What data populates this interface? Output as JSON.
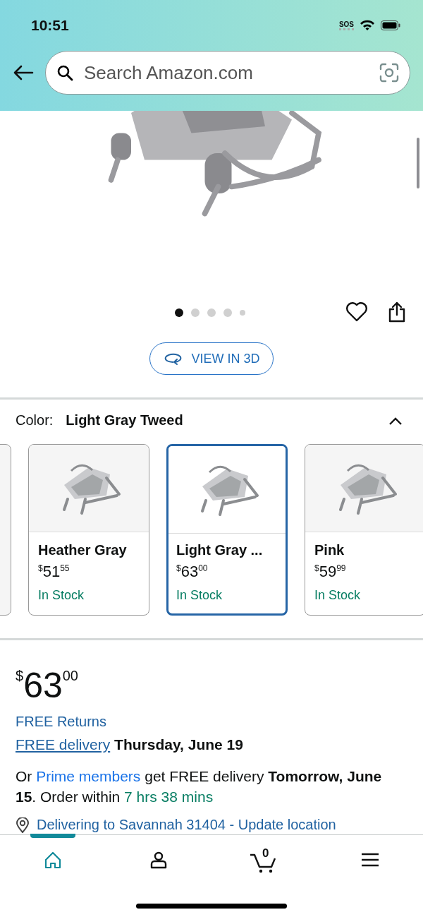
{
  "status_bar": {
    "time": "10:51",
    "sos": "SOS"
  },
  "search": {
    "placeholder": "Search Amazon.com"
  },
  "gallery": {
    "dots": [
      {
        "selected": true
      },
      {
        "selected": false
      },
      {
        "selected": false
      },
      {
        "selected": false
      },
      {
        "selected": false
      }
    ],
    "view_3d": "VIEW IN 3D"
  },
  "color": {
    "label": "Color:",
    "value": "Light Gray Tweed",
    "expanded": true
  },
  "swatches": [
    {
      "name": "Heather Gray",
      "price": {
        "currency": "$",
        "whole": "51",
        "fraction": "55"
      },
      "stock": "In Stock",
      "selected": false
    },
    {
      "name": "Light Gray ...",
      "price": {
        "currency": "$",
        "whole": "63",
        "fraction": "00"
      },
      "stock": "In Stock",
      "selected": true
    },
    {
      "name": "Pink",
      "price": {
        "currency": "$",
        "whole": "59",
        "fraction": "99"
      },
      "stock": "In Stock",
      "selected": false
    }
  ],
  "price": {
    "currency": "$",
    "whole": "63",
    "fraction": "00"
  },
  "returns": "FREE Returns",
  "delivery": [
    {
      "kind": "link",
      "text": "FREE delivery"
    },
    {
      "kind": "bold",
      "text": "Thursday, June 19"
    }
  ],
  "prime": [
    {
      "kind": "plain",
      "text": "Or "
    },
    {
      "kind": "link",
      "text": "Prime members"
    },
    {
      "kind": "plain",
      "text": " get FREE delivery "
    },
    {
      "kind": "bold",
      "text": "Tomorrow, June 15"
    },
    {
      "kind": "plain",
      "text": ". Order within "
    },
    {
      "kind": "green",
      "text": "7 hrs 38 mins"
    }
  ],
  "location": "Delivering to Savannah 31404 - Update location",
  "nav": [
    {
      "kind": "home",
      "selected": true
    },
    {
      "kind": "account",
      "selected": false
    },
    {
      "kind": "cart",
      "count": "0",
      "selected": false
    },
    {
      "kind": "menu",
      "selected": false
    }
  ]
}
